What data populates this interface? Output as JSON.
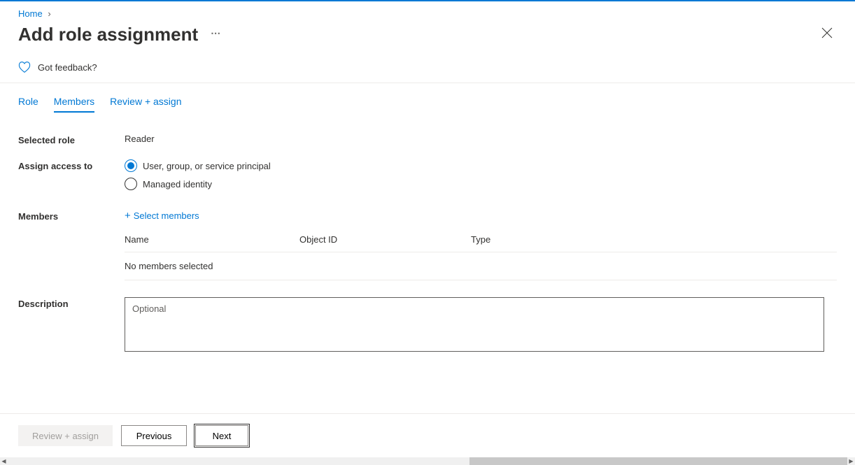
{
  "breadcrumb": {
    "home": "Home"
  },
  "page": {
    "title": "Add role assignment"
  },
  "feedback": {
    "text": "Got feedback?"
  },
  "tabs": {
    "role": "Role",
    "members": "Members",
    "review": "Review + assign"
  },
  "form": {
    "selectedRoleLabel": "Selected role",
    "selectedRoleValue": "Reader",
    "assignAccessLabel": "Assign access to",
    "radio1": "User, group, or service principal",
    "radio2": "Managed identity",
    "membersLabel": "Members",
    "selectMembers": "Select members",
    "table": {
      "colName": "Name",
      "colObjectId": "Object ID",
      "colType": "Type",
      "empty": "No members selected"
    },
    "descriptionLabel": "Description",
    "descriptionPlaceholder": "Optional"
  },
  "footer": {
    "reviewAssign": "Review + assign",
    "previous": "Previous",
    "next": "Next"
  }
}
